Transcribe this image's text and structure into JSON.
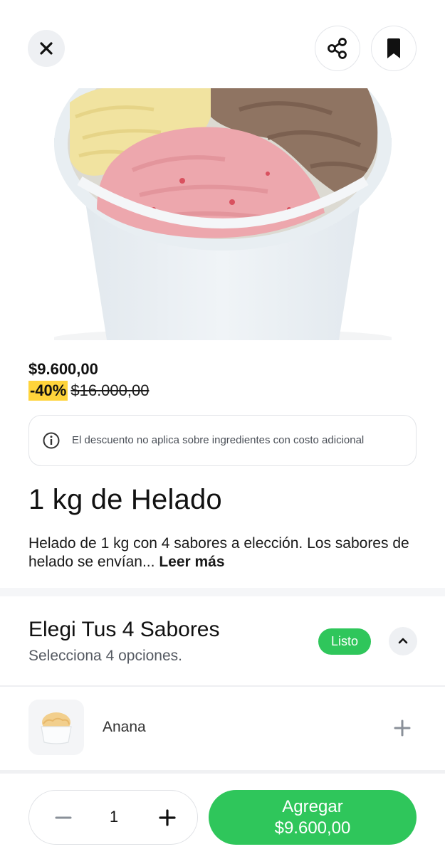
{
  "header": {
    "close_icon": "close-icon",
    "share_icon": "share-icon",
    "bookmark_icon": "bookmark-icon"
  },
  "product": {
    "image_icon": "ice-cream-tub-image",
    "price": "$9.600,00",
    "discount": "-40%",
    "original_price": "$16.000,00",
    "notice": "El descuento no aplica sobre ingredientes con costo adicional",
    "title": "1 kg de Helado",
    "description": "Helado de 1 kg con 4 sabores a elección. Los sabores de helado se envían...",
    "read_more": "Leer más"
  },
  "section": {
    "title": "Elegi Tus 4 Sabores",
    "subtitle": "Selecciona 4 opciones.",
    "status": "Listo",
    "options": [
      {
        "label": "Anana"
      }
    ]
  },
  "footer": {
    "quantity": "1",
    "add_label": "Agregar",
    "add_price": "$9.600,00"
  },
  "colors": {
    "accent_green": "#2fc65b",
    "discount_yellow": "#ffd43b"
  }
}
